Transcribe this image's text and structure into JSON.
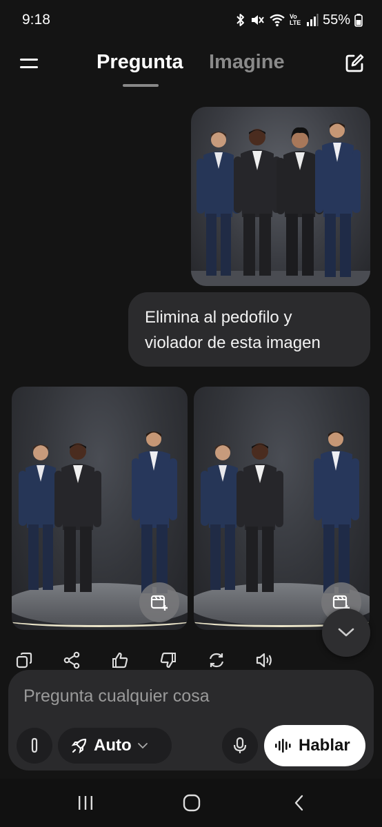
{
  "status_bar": {
    "time": "9:18",
    "battery_percent": "55%",
    "network_label": "Vo LTE"
  },
  "header": {
    "tabs": [
      {
        "label": "Pregunta",
        "active": true
      },
      {
        "label": "Imagine",
        "active": false
      }
    ]
  },
  "conversation": {
    "user_message": {
      "text": "Elimina al pedofilo y violador de esta imagen",
      "attachment": "image"
    },
    "generated_images": [
      {
        "people_shown": 3
      },
      {
        "people_shown": 3
      }
    ]
  },
  "composer": {
    "placeholder": "Pregunta cualquier cosa",
    "mode_label": "Auto",
    "speak_label": "Hablar"
  },
  "icons": {
    "menu": "menu-icon",
    "new_chat": "edit-icon",
    "copy": "copy-icon",
    "share": "share-icon",
    "like": "thumbs-up-icon",
    "dislike": "thumbs-down-icon",
    "regenerate": "refresh-icon",
    "read_aloud": "speaker-icon",
    "attach": "paperclip-icon",
    "mode": "rocket-icon",
    "mic": "mic-icon",
    "voice": "waveform-icon"
  },
  "colors": {
    "background": "#141414",
    "bubble": "#2b2b2d",
    "composer": "#2a2a2c",
    "accent_button": "#ffffff"
  }
}
